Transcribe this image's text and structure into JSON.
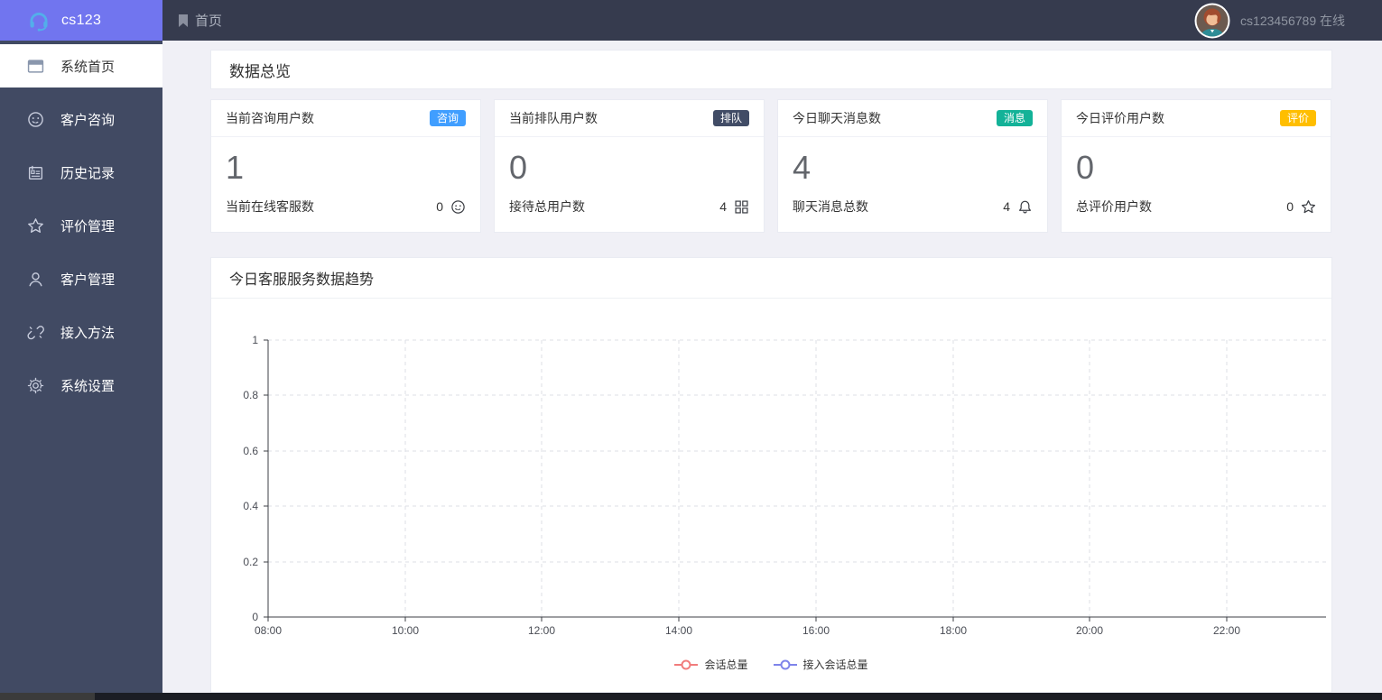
{
  "brand": {
    "logo_text": "cs123",
    "logo_icon": "headset-icon",
    "accent_color": "#7175ef"
  },
  "topbar": {
    "background": "#363b4e",
    "breadcrumb_icon": "bookmark-icon",
    "breadcrumb_tab": "首页",
    "username_status": "cs123456789 在线"
  },
  "sidebar": {
    "background": "#414a63",
    "items": [
      {
        "label": "系统首页",
        "icon": "window-icon",
        "active": true
      },
      {
        "label": "客户咨询",
        "icon": "smiley-icon",
        "active": false
      },
      {
        "label": "历史记录",
        "icon": "notebook-icon",
        "active": false
      },
      {
        "label": "评价管理",
        "icon": "star-icon",
        "active": false
      },
      {
        "label": "客户管理",
        "icon": "user-icon",
        "active": false
      },
      {
        "label": "接入方法",
        "icon": "link-icon",
        "active": false
      },
      {
        "label": "系统设置",
        "icon": "gear-icon",
        "active": false
      }
    ]
  },
  "overview": {
    "title": "数据总览"
  },
  "stat_cards": [
    {
      "title": "当前咨询用户数",
      "badge": "咨询",
      "badge_color": "#409eff",
      "value": "1",
      "sub_label": "当前在线客服数",
      "sub_value": "0",
      "sub_icon": "smiley-icon"
    },
    {
      "title": "当前排队用户数",
      "badge": "排队",
      "badge_color": "#414c66",
      "value": "0",
      "sub_label": "接待总用户数",
      "sub_value": "4",
      "sub_icon": "grid-icon"
    },
    {
      "title": "今日聊天消息数",
      "badge": "消息",
      "badge_color": "#13b298",
      "value": "4",
      "sub_label": "聊天消息总数",
      "sub_value": "4",
      "sub_icon": "bell-icon"
    },
    {
      "title": "今日评价用户数",
      "badge": "评价",
      "badge_color": "#ffbe00",
      "value": "0",
      "sub_label": "总评价用户数",
      "sub_value": "0",
      "sub_icon": "star-icon"
    }
  ],
  "trend_panel": {
    "title": "今日客服服务数据趋势"
  },
  "chart_data": {
    "type": "line",
    "title": "今日客服服务数据趋势",
    "x_tick_labels": [
      "08:00",
      "10:00",
      "12:00",
      "14:00",
      "16:00",
      "18:00",
      "20:00",
      "22:00"
    ],
    "y_tick_labels": [
      "0",
      "0.2",
      "0.4",
      "0.6",
      "0.8",
      "1"
    ],
    "ylim": [
      0,
      1
    ],
    "xlabel": "",
    "ylabel": "",
    "grid": "dashed",
    "legend_position": "bottom",
    "series": [
      {
        "name": "会话总量",
        "color": "#f17c7c",
        "values": []
      },
      {
        "name": "接入会话总量",
        "color": "#7e84ea",
        "values": []
      }
    ],
    "note": "chart area is empty - no data points plotted"
  }
}
